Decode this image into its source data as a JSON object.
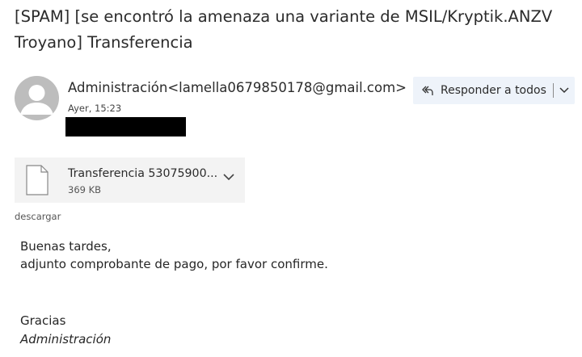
{
  "email": {
    "subject": "[SPAM] [se encontró la amenaza una variante de MSIL/Kryptik.ANZV Troyano] Transferencia",
    "sender": "Administración<lamella0679850178@gmail.com>",
    "date": "Ayer, 15:23"
  },
  "actions": {
    "reply_all_label": "Responder a todos"
  },
  "attachment": {
    "name": "Transferencia 53075900...",
    "size": "369 KB",
    "download_label": "descargar"
  },
  "body": {
    "greeting": "Buenas tardes,",
    "line1": "adjunto comprobante de pago, por favor confirme.",
    "closing": "Gracias",
    "signature": "Administración"
  },
  "colors": {
    "reply_bg": "#eef3fa",
    "attachment_bg": "#f3f3f3",
    "redaction": "#000000"
  },
  "icons": {
    "avatar": "person-icon",
    "reply_all": "reply-all-icon",
    "dropdown": "chevron-down-icon",
    "file": "file-icon"
  }
}
